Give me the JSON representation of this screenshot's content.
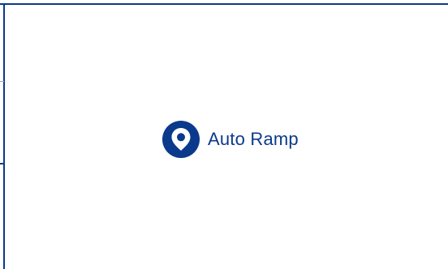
{
  "location": {
    "label": "Auto Ramp",
    "icon": "map-pin-icon"
  },
  "colors": {
    "brand": "#0b3a8c",
    "background": "#ffffff"
  }
}
